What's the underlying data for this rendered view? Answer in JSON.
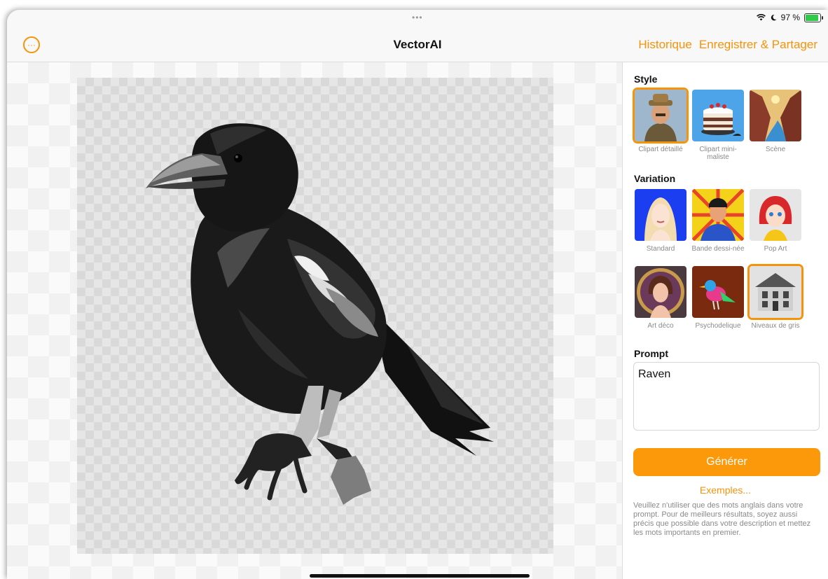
{
  "status": {
    "top_dots": "•••",
    "battery_text": "97 %"
  },
  "nav": {
    "title": "VectorAI",
    "history": "Historique",
    "save_share": "Enregistrer & Partager"
  },
  "panel": {
    "style_title": "Style",
    "styles": [
      {
        "label": "Clipart détaillé",
        "icon": "man-with-hat-thumbnail",
        "selected": true
      },
      {
        "label": "Clipart mini-maliste",
        "icon": "cake-thumbnail",
        "selected": false
      },
      {
        "label": "Scène",
        "icon": "canyon-river-thumbnail",
        "selected": false
      }
    ],
    "variation_title": "Variation",
    "variations": [
      {
        "label": "Standard",
        "icon": "blonde-woman-thumbnail",
        "selected": false
      },
      {
        "label": "Bande dessi-née",
        "icon": "comic-hero-thumbnail",
        "selected": false
      },
      {
        "label": "Pop Art",
        "icon": "red-hair-girl-thumbnail",
        "selected": false
      },
      {
        "label": "Art déco",
        "icon": "art-deco-woman-thumbnail",
        "selected": false
      },
      {
        "label": "Psychodelique",
        "icon": "colorful-bird-thumbnail",
        "selected": false
      },
      {
        "label": "Niveaux de gris",
        "icon": "gray-house-thumbnail",
        "selected": true
      }
    ],
    "prompt_title": "Prompt",
    "prompt_value": "Raven",
    "generate": "Générer",
    "examples": "Exemples...",
    "help": "Veuillez n'utiliser que des mots anglais dans votre prompt. Pour de meilleurs résultats, soyez aussi précis que possible dans votre description et mettez les mots importants en premier."
  },
  "colors": {
    "accent": "#f5930b",
    "button": "#fc990b",
    "selected_border": "#f5930b"
  }
}
